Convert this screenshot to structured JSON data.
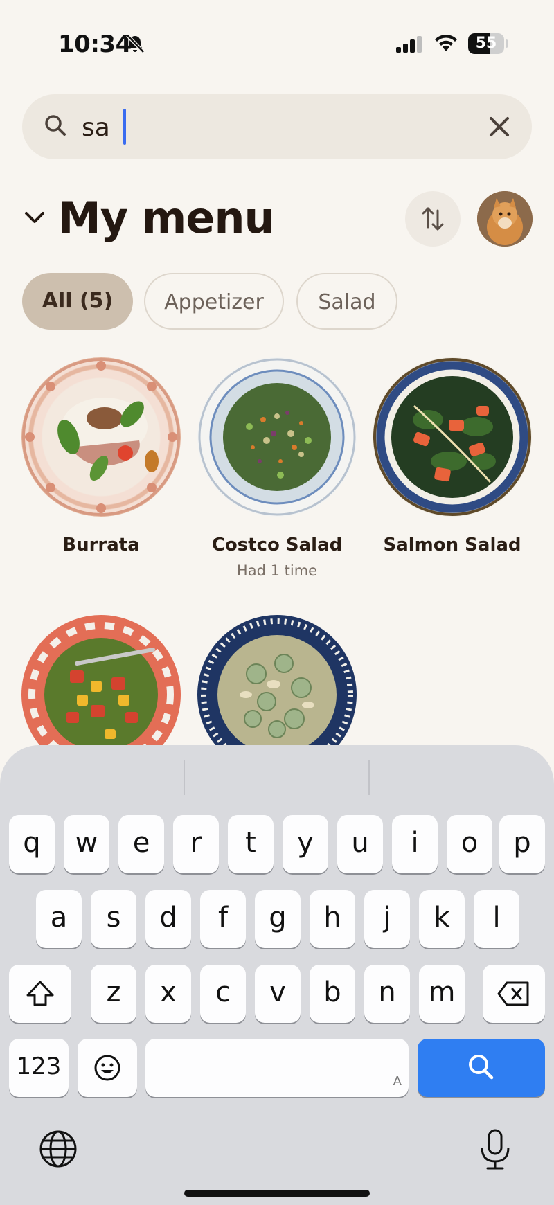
{
  "status_bar": {
    "time": "10:34",
    "battery": "55"
  },
  "search": {
    "query": "sa",
    "placeholder": ""
  },
  "header": {
    "title": "My menu"
  },
  "filters": [
    {
      "label": "All (5)",
      "active": true
    },
    {
      "label": "Appetizer",
      "active": false
    },
    {
      "label": "Salad",
      "active": false
    }
  ],
  "dishes": [
    {
      "name": "Burrata",
      "subtitle": ""
    },
    {
      "name": "Costco Salad",
      "subtitle": "Had 1 time"
    },
    {
      "name": "Salmon Salad",
      "subtitle": ""
    }
  ],
  "keyboard": {
    "row1": [
      "q",
      "w",
      "e",
      "r",
      "t",
      "y",
      "u",
      "i",
      "o",
      "p"
    ],
    "row2": [
      "a",
      "s",
      "d",
      "f",
      "g",
      "h",
      "j",
      "k",
      "l"
    ],
    "row3": [
      "z",
      "x",
      "c",
      "v",
      "b",
      "n",
      "m"
    ],
    "numbers_key": "123",
    "space_hint": "A"
  },
  "colors": {
    "accent_blue": "#2f7ef2",
    "chip_active": "#cdbfae",
    "background": "#f8f5f0"
  }
}
